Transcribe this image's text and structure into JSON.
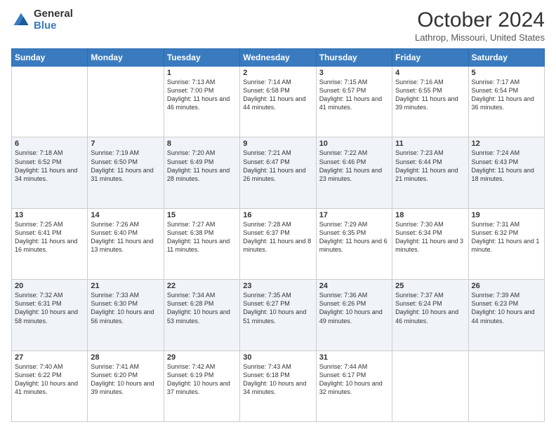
{
  "header": {
    "logo_general": "General",
    "logo_blue": "Blue",
    "month_title": "October 2024",
    "location": "Lathrop, Missouri, United States"
  },
  "days_of_week": [
    "Sunday",
    "Monday",
    "Tuesday",
    "Wednesday",
    "Thursday",
    "Friday",
    "Saturday"
  ],
  "weeks": [
    [
      {
        "num": "",
        "sunrise": "",
        "sunset": "",
        "daylight": ""
      },
      {
        "num": "",
        "sunrise": "",
        "sunset": "",
        "daylight": ""
      },
      {
        "num": "1",
        "sunrise": "Sunrise: 7:13 AM",
        "sunset": "Sunset: 7:00 PM",
        "daylight": "Daylight: 11 hours and 46 minutes."
      },
      {
        "num": "2",
        "sunrise": "Sunrise: 7:14 AM",
        "sunset": "Sunset: 6:58 PM",
        "daylight": "Daylight: 11 hours and 44 minutes."
      },
      {
        "num": "3",
        "sunrise": "Sunrise: 7:15 AM",
        "sunset": "Sunset: 6:57 PM",
        "daylight": "Daylight: 11 hours and 41 minutes."
      },
      {
        "num": "4",
        "sunrise": "Sunrise: 7:16 AM",
        "sunset": "Sunset: 6:55 PM",
        "daylight": "Daylight: 11 hours and 39 minutes."
      },
      {
        "num": "5",
        "sunrise": "Sunrise: 7:17 AM",
        "sunset": "Sunset: 6:54 PM",
        "daylight": "Daylight: 11 hours and 36 minutes."
      }
    ],
    [
      {
        "num": "6",
        "sunrise": "Sunrise: 7:18 AM",
        "sunset": "Sunset: 6:52 PM",
        "daylight": "Daylight: 11 hours and 34 minutes."
      },
      {
        "num": "7",
        "sunrise": "Sunrise: 7:19 AM",
        "sunset": "Sunset: 6:50 PM",
        "daylight": "Daylight: 11 hours and 31 minutes."
      },
      {
        "num": "8",
        "sunrise": "Sunrise: 7:20 AM",
        "sunset": "Sunset: 6:49 PM",
        "daylight": "Daylight: 11 hours and 28 minutes."
      },
      {
        "num": "9",
        "sunrise": "Sunrise: 7:21 AM",
        "sunset": "Sunset: 6:47 PM",
        "daylight": "Daylight: 11 hours and 26 minutes."
      },
      {
        "num": "10",
        "sunrise": "Sunrise: 7:22 AM",
        "sunset": "Sunset: 6:46 PM",
        "daylight": "Daylight: 11 hours and 23 minutes."
      },
      {
        "num": "11",
        "sunrise": "Sunrise: 7:23 AM",
        "sunset": "Sunset: 6:44 PM",
        "daylight": "Daylight: 11 hours and 21 minutes."
      },
      {
        "num": "12",
        "sunrise": "Sunrise: 7:24 AM",
        "sunset": "Sunset: 6:43 PM",
        "daylight": "Daylight: 11 hours and 18 minutes."
      }
    ],
    [
      {
        "num": "13",
        "sunrise": "Sunrise: 7:25 AM",
        "sunset": "Sunset: 6:41 PM",
        "daylight": "Daylight: 11 hours and 16 minutes."
      },
      {
        "num": "14",
        "sunrise": "Sunrise: 7:26 AM",
        "sunset": "Sunset: 6:40 PM",
        "daylight": "Daylight: 11 hours and 13 minutes."
      },
      {
        "num": "15",
        "sunrise": "Sunrise: 7:27 AM",
        "sunset": "Sunset: 6:38 PM",
        "daylight": "Daylight: 11 hours and 11 minutes."
      },
      {
        "num": "16",
        "sunrise": "Sunrise: 7:28 AM",
        "sunset": "Sunset: 6:37 PM",
        "daylight": "Daylight: 11 hours and 8 minutes."
      },
      {
        "num": "17",
        "sunrise": "Sunrise: 7:29 AM",
        "sunset": "Sunset: 6:35 PM",
        "daylight": "Daylight: 11 hours and 6 minutes."
      },
      {
        "num": "18",
        "sunrise": "Sunrise: 7:30 AM",
        "sunset": "Sunset: 6:34 PM",
        "daylight": "Daylight: 11 hours and 3 minutes."
      },
      {
        "num": "19",
        "sunrise": "Sunrise: 7:31 AM",
        "sunset": "Sunset: 6:32 PM",
        "daylight": "Daylight: 11 hours and 1 minute."
      }
    ],
    [
      {
        "num": "20",
        "sunrise": "Sunrise: 7:32 AM",
        "sunset": "Sunset: 6:31 PM",
        "daylight": "Daylight: 10 hours and 58 minutes."
      },
      {
        "num": "21",
        "sunrise": "Sunrise: 7:33 AM",
        "sunset": "Sunset: 6:30 PM",
        "daylight": "Daylight: 10 hours and 56 minutes."
      },
      {
        "num": "22",
        "sunrise": "Sunrise: 7:34 AM",
        "sunset": "Sunset: 6:28 PM",
        "daylight": "Daylight: 10 hours and 53 minutes."
      },
      {
        "num": "23",
        "sunrise": "Sunrise: 7:35 AM",
        "sunset": "Sunset: 6:27 PM",
        "daylight": "Daylight: 10 hours and 51 minutes."
      },
      {
        "num": "24",
        "sunrise": "Sunrise: 7:36 AM",
        "sunset": "Sunset: 6:26 PM",
        "daylight": "Daylight: 10 hours and 49 minutes."
      },
      {
        "num": "25",
        "sunrise": "Sunrise: 7:37 AM",
        "sunset": "Sunset: 6:24 PM",
        "daylight": "Daylight: 10 hours and 46 minutes."
      },
      {
        "num": "26",
        "sunrise": "Sunrise: 7:39 AM",
        "sunset": "Sunset: 6:23 PM",
        "daylight": "Daylight: 10 hours and 44 minutes."
      }
    ],
    [
      {
        "num": "27",
        "sunrise": "Sunrise: 7:40 AM",
        "sunset": "Sunset: 6:22 PM",
        "daylight": "Daylight: 10 hours and 41 minutes."
      },
      {
        "num": "28",
        "sunrise": "Sunrise: 7:41 AM",
        "sunset": "Sunset: 6:20 PM",
        "daylight": "Daylight: 10 hours and 39 minutes."
      },
      {
        "num": "29",
        "sunrise": "Sunrise: 7:42 AM",
        "sunset": "Sunset: 6:19 PM",
        "daylight": "Daylight: 10 hours and 37 minutes."
      },
      {
        "num": "30",
        "sunrise": "Sunrise: 7:43 AM",
        "sunset": "Sunset: 6:18 PM",
        "daylight": "Daylight: 10 hours and 34 minutes."
      },
      {
        "num": "31",
        "sunrise": "Sunrise: 7:44 AM",
        "sunset": "Sunset: 6:17 PM",
        "daylight": "Daylight: 10 hours and 32 minutes."
      },
      {
        "num": "",
        "sunrise": "",
        "sunset": "",
        "daylight": ""
      },
      {
        "num": "",
        "sunrise": "",
        "sunset": "",
        "daylight": ""
      }
    ]
  ]
}
